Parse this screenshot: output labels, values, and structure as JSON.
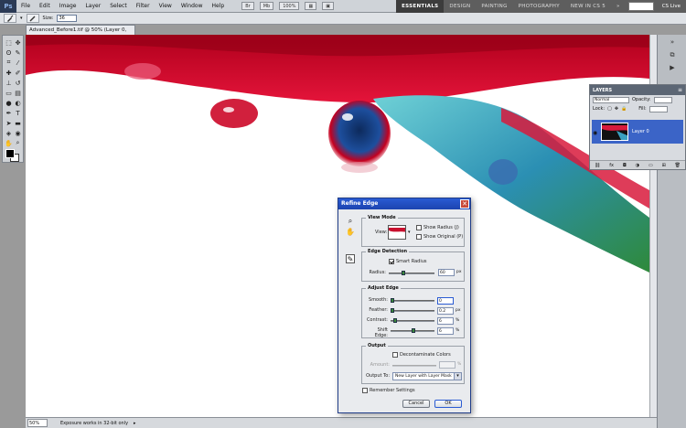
{
  "app": {
    "logo": "Ps"
  },
  "menu": [
    "File",
    "Edit",
    "Image",
    "Layer",
    "Select",
    "Filter",
    "View",
    "Window",
    "Help"
  ],
  "menu_widgets": {
    "zoom": "100%",
    "mode_icon": "screen-mode-icon"
  },
  "workspaces": {
    "active": "ESSENTIALS",
    "others": [
      "DESIGN",
      "PAINTING",
      "PHOTOGRAPHY",
      "NEW IN CS 5"
    ],
    "cs_live": "CS Live"
  },
  "options_bar": {
    "size_label": "Size:",
    "size_value": "36"
  },
  "document": {
    "tab_title": "Advanced_Before1.tif @ 50% (Layer 0, RGB/8) *"
  },
  "status": {
    "zoom": "50%",
    "message": "Exposure works in 32-bit only"
  },
  "layers_panel": {
    "tab": "LAYERS",
    "blend_mode": "Normal",
    "opacity_label": "Opacity:",
    "lock_label": "Lock:",
    "fill_label": "Fill:",
    "layer_name": "Layer 0",
    "footer_icons": [
      "link-icon",
      "fx-icon",
      "mask-icon",
      "adjustment-icon",
      "folder-icon",
      "new-layer-icon",
      "trash-icon"
    ]
  },
  "refine_edge": {
    "title": "Refine Edge",
    "close": "✕",
    "view_mode": {
      "legend": "View Mode",
      "view_label": "View:",
      "show_radius": "Show Radius (J)",
      "show_original": "Show Original (P)"
    },
    "edge_detection": {
      "legend": "Edge Detection",
      "smart_radius": "Smart Radius",
      "radius_label": "Radius:",
      "radius_value": "60",
      "radius_unit": "px",
      "radius_fraction": 0.3
    },
    "adjust_edge": {
      "legend": "Adjust Edge",
      "rows": [
        {
          "label": "Smooth:",
          "value": "0",
          "unit": "",
          "fraction": 0.0
        },
        {
          "label": "Feather:",
          "value": "0.2",
          "unit": "px",
          "fraction": 0.01
        },
        {
          "label": "Contrast:",
          "value": "6",
          "unit": "%",
          "fraction": 0.06
        },
        {
          "label": "Shift Edge:",
          "value": "6",
          "unit": "%",
          "fraction": 0.53
        }
      ]
    },
    "output": {
      "legend": "Output",
      "decontaminate": "Decontaminate Colors",
      "amount_label": "Amount:",
      "amount_unit": "%",
      "output_to_label": "Output To:",
      "output_to_value": "New Layer with Layer Mask"
    },
    "remember": "Remember Settings",
    "cancel": "Cancel",
    "ok": "OK"
  }
}
